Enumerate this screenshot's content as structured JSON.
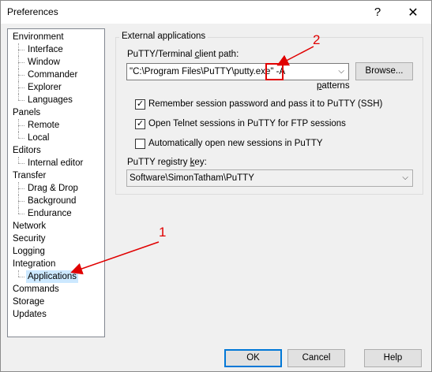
{
  "window": {
    "title": "Preferences",
    "help_glyph": "?",
    "close_glyph": "✕"
  },
  "tree": {
    "items": [
      {
        "label": "Environment",
        "level": 0
      },
      {
        "label": "Interface",
        "level": 1
      },
      {
        "label": "Window",
        "level": 1
      },
      {
        "label": "Commander",
        "level": 1
      },
      {
        "label": "Explorer",
        "level": 1
      },
      {
        "label": "Languages",
        "level": 1
      },
      {
        "label": "Panels",
        "level": 0
      },
      {
        "label": "Remote",
        "level": 1
      },
      {
        "label": "Local",
        "level": 1
      },
      {
        "label": "Editors",
        "level": 0
      },
      {
        "label": "Internal editor",
        "level": 1
      },
      {
        "label": "Transfer",
        "level": 0
      },
      {
        "label": "Drag & Drop",
        "level": 1
      },
      {
        "label": "Background",
        "level": 1
      },
      {
        "label": "Endurance",
        "level": 1
      },
      {
        "label": "Network",
        "level": 0
      },
      {
        "label": "Security",
        "level": 0
      },
      {
        "label": "Logging",
        "level": 0
      },
      {
        "label": "Integration",
        "level": 0
      },
      {
        "label": "Applications",
        "level": 1,
        "selected": true
      },
      {
        "label": "Commands",
        "level": 0
      },
      {
        "label": "Storage",
        "level": 0
      },
      {
        "label": "Updates",
        "level": 0
      }
    ]
  },
  "external": {
    "group_label": "External applications",
    "putty_path_label": "PuTTY/Terminal client path:",
    "putty_path_value": "\"C:\\Program Files\\PuTTY\\putty.exe\" -A",
    "browse_label": "Browse...",
    "patterns_label": "patterns",
    "remember_password_label": "Remember session password and pass it to PuTTY (SSH)",
    "remember_password_checked": true,
    "open_telnet_label": "Open Telnet sessions in PuTTY for FTP sessions",
    "open_telnet_checked": true,
    "auto_open_label": "Automatically open new sessions in PuTTY",
    "auto_open_checked": false,
    "registry_key_label": "PuTTY registry key:",
    "registry_key_value": "Software\\SimonTatham\\PuTTY"
  },
  "annotations": {
    "marker_1": "1",
    "marker_2": "2"
  },
  "footer": {
    "ok_label": "OK",
    "cancel_label": "Cancel",
    "help_label": "Help"
  },
  "colors": {
    "annotation": "#e00000",
    "selection": "#cce8ff",
    "default_button_border": "#0078d7"
  },
  "icons": {
    "dropdown": "chevron-down-icon",
    "check": "checkmark-icon"
  }
}
